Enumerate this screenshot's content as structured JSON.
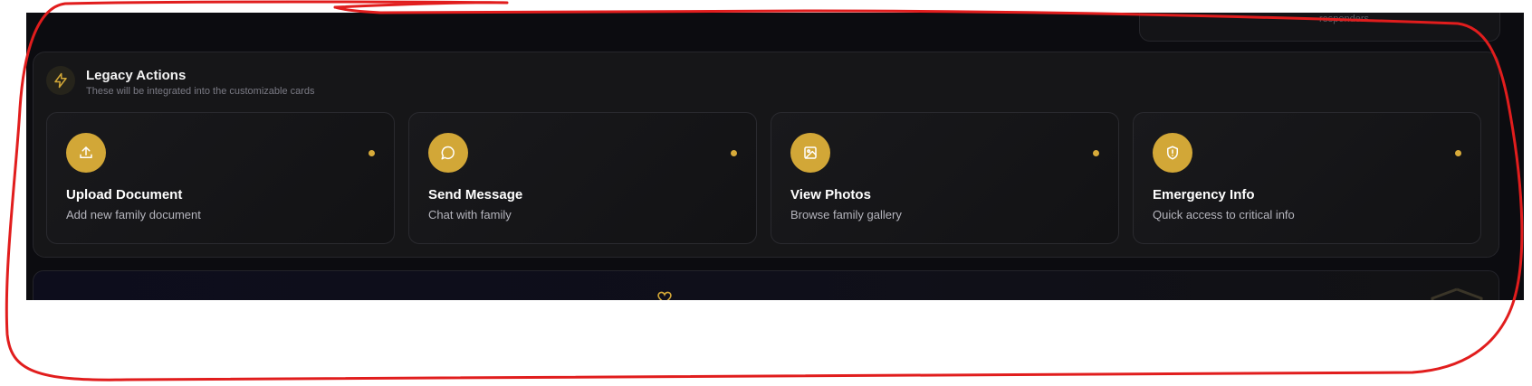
{
  "top_card": {
    "text": "responders"
  },
  "panel": {
    "title": "Legacy Actions",
    "subtitle": "These will be integrated into the customizable cards",
    "icon": "lightning-icon"
  },
  "cards": [
    {
      "title": "Upload Document",
      "description": "Add new family document",
      "icon": "upload-icon"
    },
    {
      "title": "Send Message",
      "description": "Chat with family",
      "icon": "message-icon"
    },
    {
      "title": "View Photos",
      "description": "Browse family gallery",
      "icon": "image-icon"
    },
    {
      "title": "Emergency Info",
      "description": "Quick access to critical info",
      "icon": "shield-alert-icon"
    }
  ],
  "colors": {
    "accent": "#d2a737",
    "background": "#0c0c10",
    "panel": "#161618",
    "annotation": "#e11d1d"
  }
}
